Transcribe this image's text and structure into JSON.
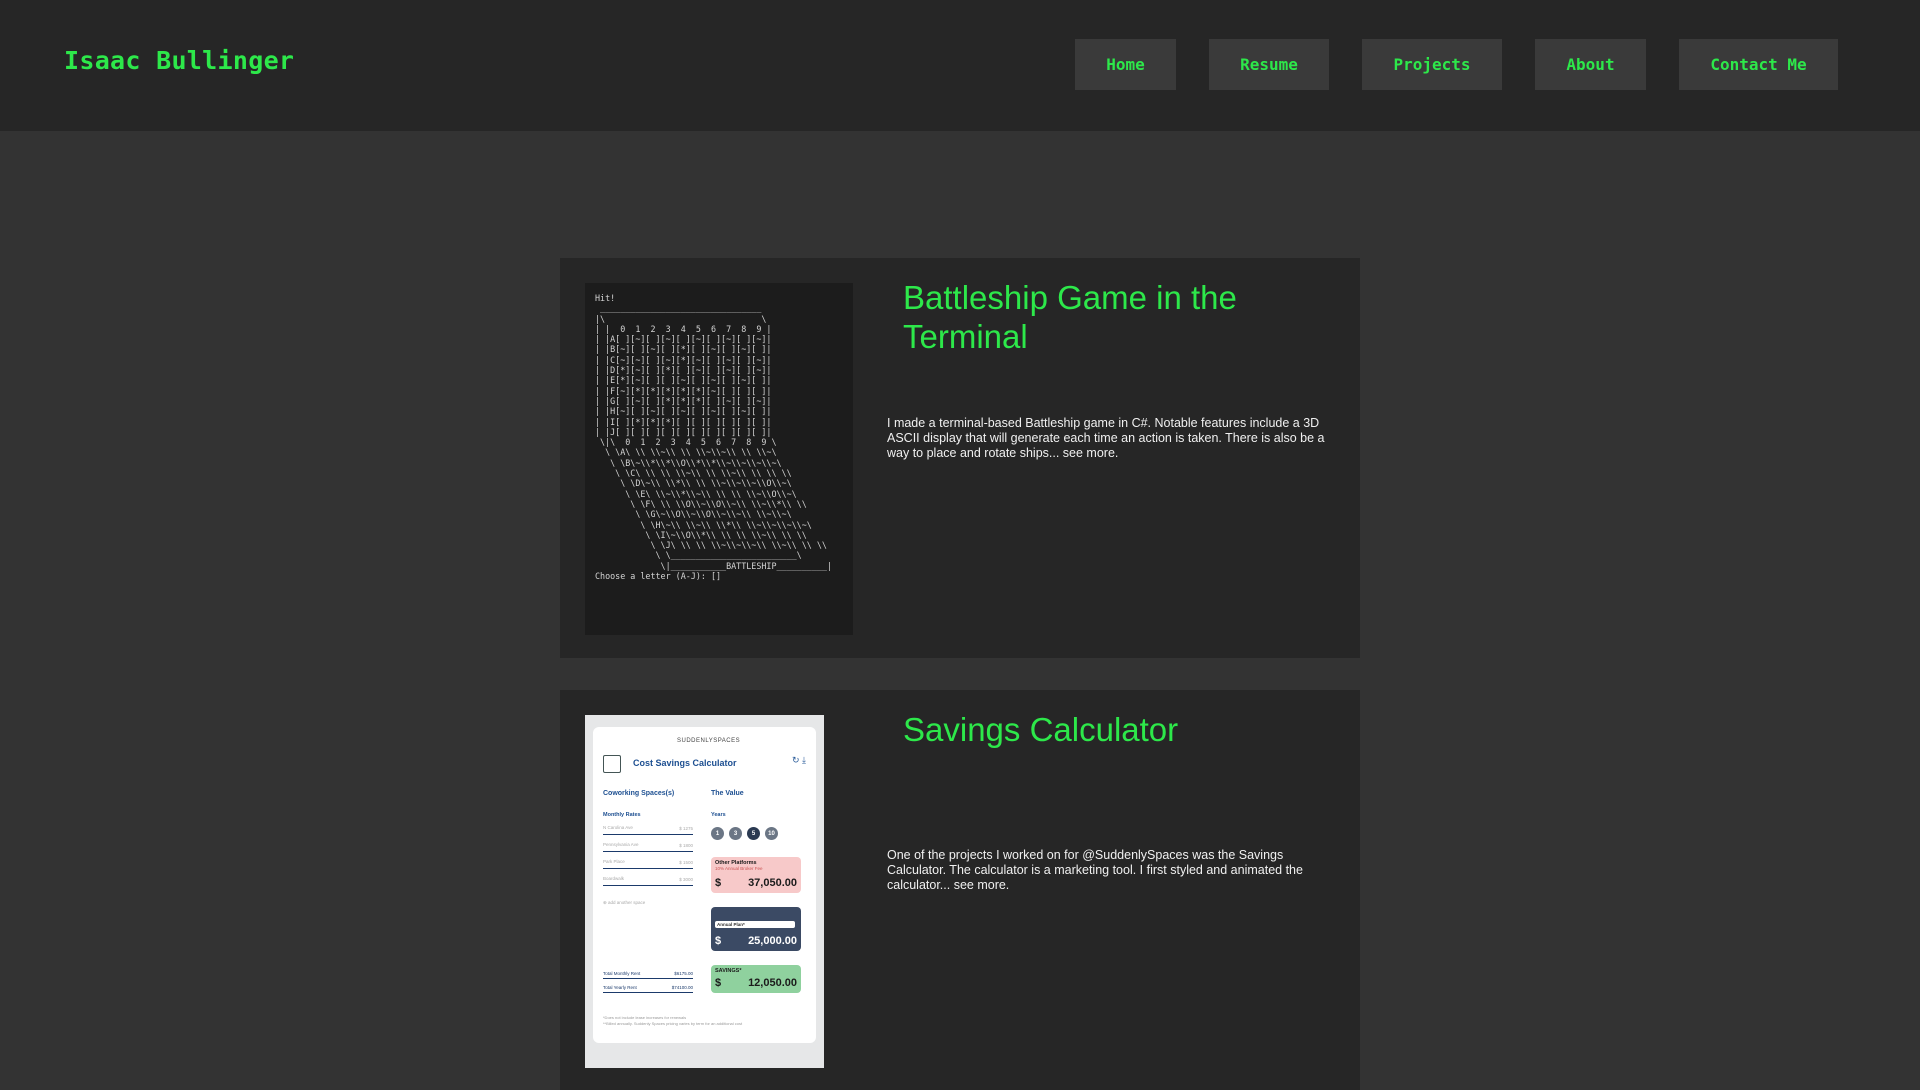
{
  "header": {
    "brand": "Isaac Bullinger",
    "nav": [
      {
        "label": "Home"
      },
      {
        "label": "Resume"
      },
      {
        "label": "Projects"
      },
      {
        "label": "About"
      },
      {
        "label": "Contact Me"
      }
    ]
  },
  "projects": [
    {
      "title": "Battleship Game in the Terminal",
      "description": "I made a terminal-based Battleship game in C#.  Notable features include a 3D ASCII display that will generate each time an action is taken. There is also be a way to place and rotate ships... see more.",
      "terminal_lines": [
        "Hit!",
        " ________________________________",
        "|\\                               \\",
        "| |  0  1  2  3  4  5  6  7  8  9 |",
        "| |A[ ][~][ ][~][ ][~][ ][~][ ][~]|",
        "| |B[~][ ][~][ ][*][ ][~][ ][~][ ]|",
        "| |C[~][~][ ][~][*][~][ ][~][ ][~]|",
        "| |D[*][~][ ][*][ ][~][ ][~][ ][~]|",
        "| |E[*][~][ ][ ][~][ ][~][ ][~][ ]|",
        "| |F[~][*][*][*][*][*][~][ ][ ][ ]|",
        "| |G[ ][~][ ][*][*][*][ ][~][ ][~]|",
        "| |H[~][ ][~][ ][~][ ][~][ ][~][ ]|",
        "| |I[ ][*][*][*][ ][ ][ ][ ][ ][ ]|",
        "| |J[ ][ ][ ][ ][ ][ ][ ][ ][ ][ ]|",
        " \\|\\  0  1  2  3  4  5  6  7  8  9 \\",
        "  \\ \\A\\ \\\\ \\\\~\\\\ \\\\ \\\\~\\\\~\\\\ \\\\ \\\\~\\",
        "   \\ \\B\\~\\\\*\\\\*\\\\O\\\\*\\\\*\\\\~\\\\~\\\\~\\\\~\\",
        "    \\ \\C\\ \\\\ \\\\ \\\\~\\\\ \\\\ \\\\~\\\\ \\\\ \\\\ \\\\",
        "     \\ \\D\\~\\\\ \\\\*\\\\ \\\\ \\\\~\\\\~\\\\~\\\\O\\\\~\\",
        "      \\ \\E\\ \\\\~\\\\*\\\\~\\\\ \\\\ \\\\ \\\\~\\\\O\\\\~\\",
        "       \\ \\F\\ \\\\ \\\\O\\\\~\\\\O\\\\~\\\\ \\\\~\\\\*\\\\ \\\\",
        "        \\ \\G\\~\\\\O\\\\~\\\\O\\\\~\\\\~\\\\ \\\\~\\\\~\\",
        "         \\ \\H\\~\\\\ \\\\~\\\\ \\\\*\\\\ \\\\~\\\\~\\\\~\\\\~\\",
        "          \\ \\I\\~\\\\O\\\\*\\\\ \\\\ \\\\ \\\\~\\\\ \\\\ \\\\",
        "           \\ \\J\\ \\\\ \\\\ \\\\~\\\\~\\\\~\\\\ \\\\~\\\\ \\\\ \\\\",
        "            \\ \\_________________________\\",
        "             \\|___________BATTLESHIP__________|",
        "Choose a letter (A-J): []"
      ]
    },
    {
      "title": "Savings Calculator",
      "description": "One of the projects I worked on for  @SuddenlySpaces was the Savings Calculator. The calculator is a marketing tool. I first styled and animated the calculator... see more.",
      "calc": {
        "brand": "SUDDENLYSPACES",
        "title": "Cost Savings Calculator",
        "left_heading": "Coworking Spaces(s)",
        "right_heading": "The Value",
        "monthly_rates": "Monthly Rates",
        "years_label": "Years",
        "rates": [
          {
            "name": "N Carolina Ave",
            "value": "$     1275"
          },
          {
            "name": "Pennsylvania Ave",
            "value": "$     1800"
          },
          {
            "name": "Park Place",
            "value": "$     1500"
          },
          {
            "name": "Boardwalk",
            "value": "$     3000"
          }
        ],
        "add_space": "add another space",
        "years": [
          "1",
          "3",
          "5",
          "10"
        ],
        "other_label": "Other Platforms",
        "other_sub": "10% Annual Broker Fee",
        "other_currency": "$",
        "other_amount": "37,050.00",
        "plan_select": "Annual Plan*",
        "suddenly_currency": "$",
        "suddenly_amount": "25,000.00",
        "savings_label": "SAVINGS*",
        "savings_currency": "$",
        "savings_amount": "12,050.00",
        "total_monthly_label": "Total Monthly Rent",
        "total_monthly": "$6175.00",
        "total_yearly_label": "Total Yearly Rent",
        "total_yearly": "$74100.00",
        "footnote1": "*Does not include lease increases for renewals",
        "footnote2": "**Billed annually. Suddenly Spaces pricing varies by term for an additional cost"
      }
    }
  ],
  "colors": {
    "accent": "#2de84a",
    "header_bg": "#262626",
    "page_bg": "#333333",
    "card_bg": "#262626",
    "nav_bg": "#3a3a3a"
  }
}
